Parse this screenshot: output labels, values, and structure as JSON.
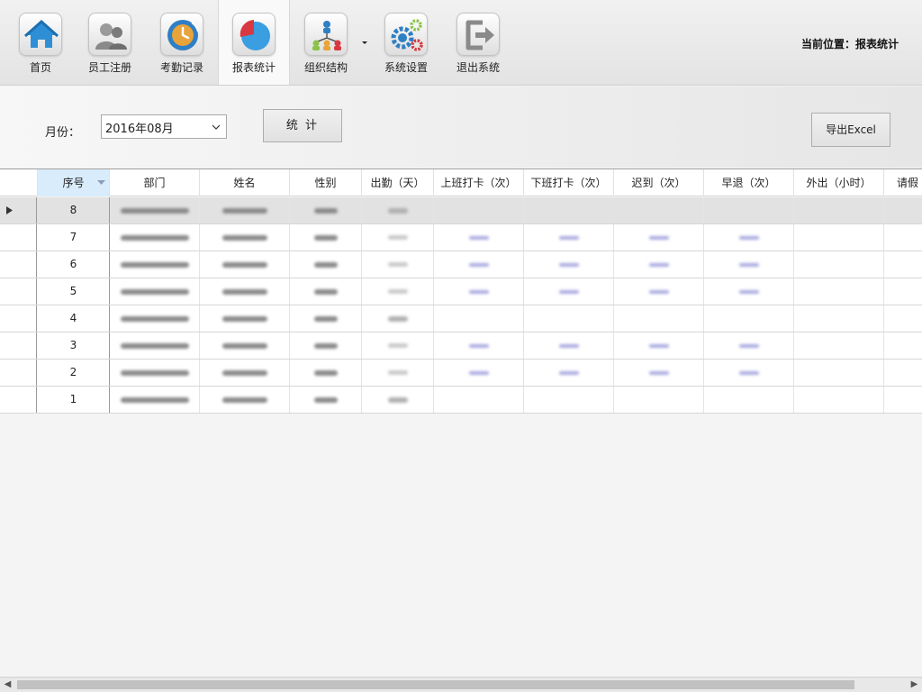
{
  "toolbar": {
    "items": [
      {
        "label": "首页",
        "icon": "home-icon"
      },
      {
        "label": "员工注册",
        "icon": "users-icon"
      },
      {
        "label": "考勤记录",
        "icon": "clock-icon"
      },
      {
        "label": "报表统计",
        "icon": "pie-chart-icon"
      },
      {
        "label": "组织结构",
        "icon": "org-chart-icon"
      },
      {
        "label": "系统设置",
        "icon": "gears-icon"
      },
      {
        "label": "退出系统",
        "icon": "logout-icon"
      }
    ],
    "active": "报表统计",
    "location": "当前位置：报表统计"
  },
  "filter": {
    "month_label": "月份：",
    "month_value": "2016年08月",
    "stat_button": "统 计",
    "export_button": "导出Excel"
  },
  "grid": {
    "columns": [
      "序号",
      "部门",
      "姓名",
      "性别",
      "出勤（天）",
      "上班打卡（次）",
      "下班打卡（次）",
      "迟到（次）",
      "早退（次）",
      "外出（小时）",
      "请假"
    ],
    "rows": [
      {
        "num": "8",
        "has_counts": false,
        "selected": true
      },
      {
        "num": "7",
        "has_counts": true,
        "selected": false
      },
      {
        "num": "6",
        "has_counts": true,
        "selected": false
      },
      {
        "num": "5",
        "has_counts": true,
        "selected": false
      },
      {
        "num": "4",
        "has_counts": false,
        "selected": false
      },
      {
        "num": "3",
        "has_counts": true,
        "selected": false
      },
      {
        "num": "2",
        "has_counts": true,
        "selected": false
      },
      {
        "num": "1",
        "has_counts": false,
        "selected": false
      }
    ]
  },
  "colors": {
    "sorted_header": "#d9ecfb",
    "selected_row": "#e2e2e2",
    "link": "#a8a8e0"
  }
}
